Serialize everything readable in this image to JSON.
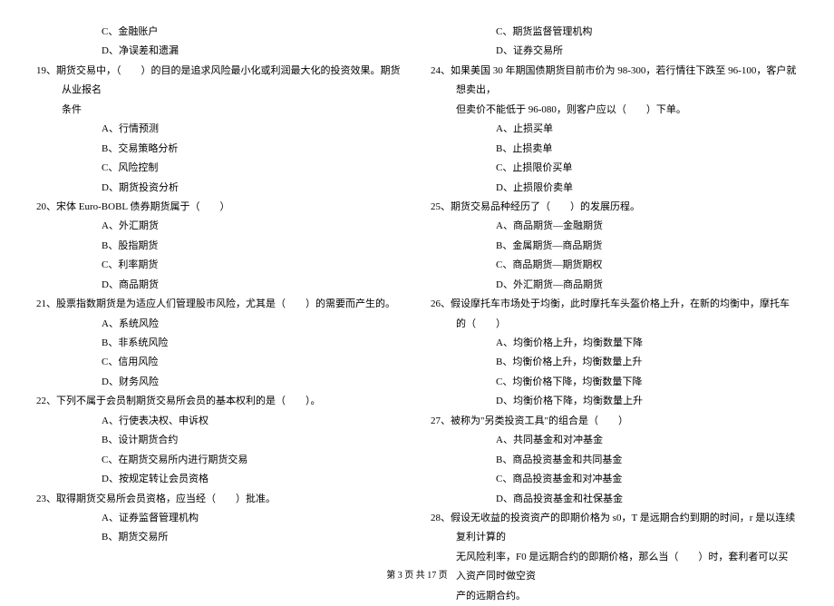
{
  "left_column": {
    "pre_options": [
      "C、金融账户",
      "D、净误差和遗漏"
    ],
    "items": [
      {
        "q": "19、期货交易中，（　　）的目的是追求风险最小化或利润最大化的投资效果。期货从业报名",
        "cont": [
          "条件"
        ],
        "opts": [
          "A、行情预测",
          "B、交易策略分析",
          "C、风险控制",
          "D、期货投资分析"
        ]
      },
      {
        "q": "20、宋体 Euro-BOBL 债券期货属于（　　）",
        "opts": [
          "A、外汇期货",
          "B、股指期货",
          "C、利率期货",
          "D、商品期货"
        ]
      },
      {
        "q": "21、股票指数期货是为适应人们管理股市风险，尤其是（　　）的需要而产生的。",
        "opts": [
          "A、系统风险",
          "B、非系统风险",
          "C、信用风险",
          "D、财务风险"
        ]
      },
      {
        "q": "22、下列不属于会员制期货交易所会员的基本权利的是（　　）。",
        "opts": [
          "A、行使表决权、申诉权",
          "B、设计期货合约",
          "C、在期货交易所内进行期货交易",
          "D、按规定转让会员资格"
        ]
      },
      {
        "q": "23、取得期货交易所会员资格，应当经（　　）批准。",
        "opts": [
          "A、证券监督管理机构",
          "B、期货交易所"
        ]
      }
    ]
  },
  "right_column": {
    "pre_options": [
      "C、期货监督管理机构",
      "D、证券交易所"
    ],
    "items": [
      {
        "q": "24、如果美国 30 年期国债期货目前市价为 98-300，若行情往下跌至 96-100，客户就想卖出，",
        "cont": [
          "但卖价不能低于 96-080，则客户应以（　　）下单。"
        ],
        "opts": [
          "A、止损买单",
          "B、止损卖单",
          "C、止损限价买单",
          "D、止损限价卖单"
        ]
      },
      {
        "q": "25、期货交易品种经历了（　　）的发展历程。",
        "opts": [
          "A、商品期货—金融期货",
          "B、金属期货—商品期货",
          "C、商品期货—期货期权",
          "D、外汇期货—商品期货"
        ]
      },
      {
        "q": "26、假设摩托车市场处于均衡，此时摩托车头盔价格上升，在新的均衡中，摩托车的（　　）",
        "opts": [
          "A、均衡价格上升，均衡数量下降",
          "B、均衡价格上升，均衡数量上升",
          "C、均衡价格下降，均衡数量下降",
          "D、均衡价格下降，均衡数量上升"
        ]
      },
      {
        "q": "27、被称为\"另类投资工具\"的组合是（　　）",
        "opts": [
          "A、共同基金和对冲基金",
          "B、商品投资基金和共同基金",
          "C、商品投资基金和对冲基金",
          "D、商品投资基金和社保基金"
        ]
      },
      {
        "q": "28、假设无收益的投资资产的即期价格为 s0，T 是远期合约到期的时间，r 是以连续复利计算的",
        "cont": [
          "无风险利率，F0 是远期合约的即期价格，那么当（　　）时，套利者可以买入资产同时做空资",
          "产的远期合约。"
        ],
        "opts": []
      }
    ]
  },
  "footer": "第 3 页 共 17 页"
}
